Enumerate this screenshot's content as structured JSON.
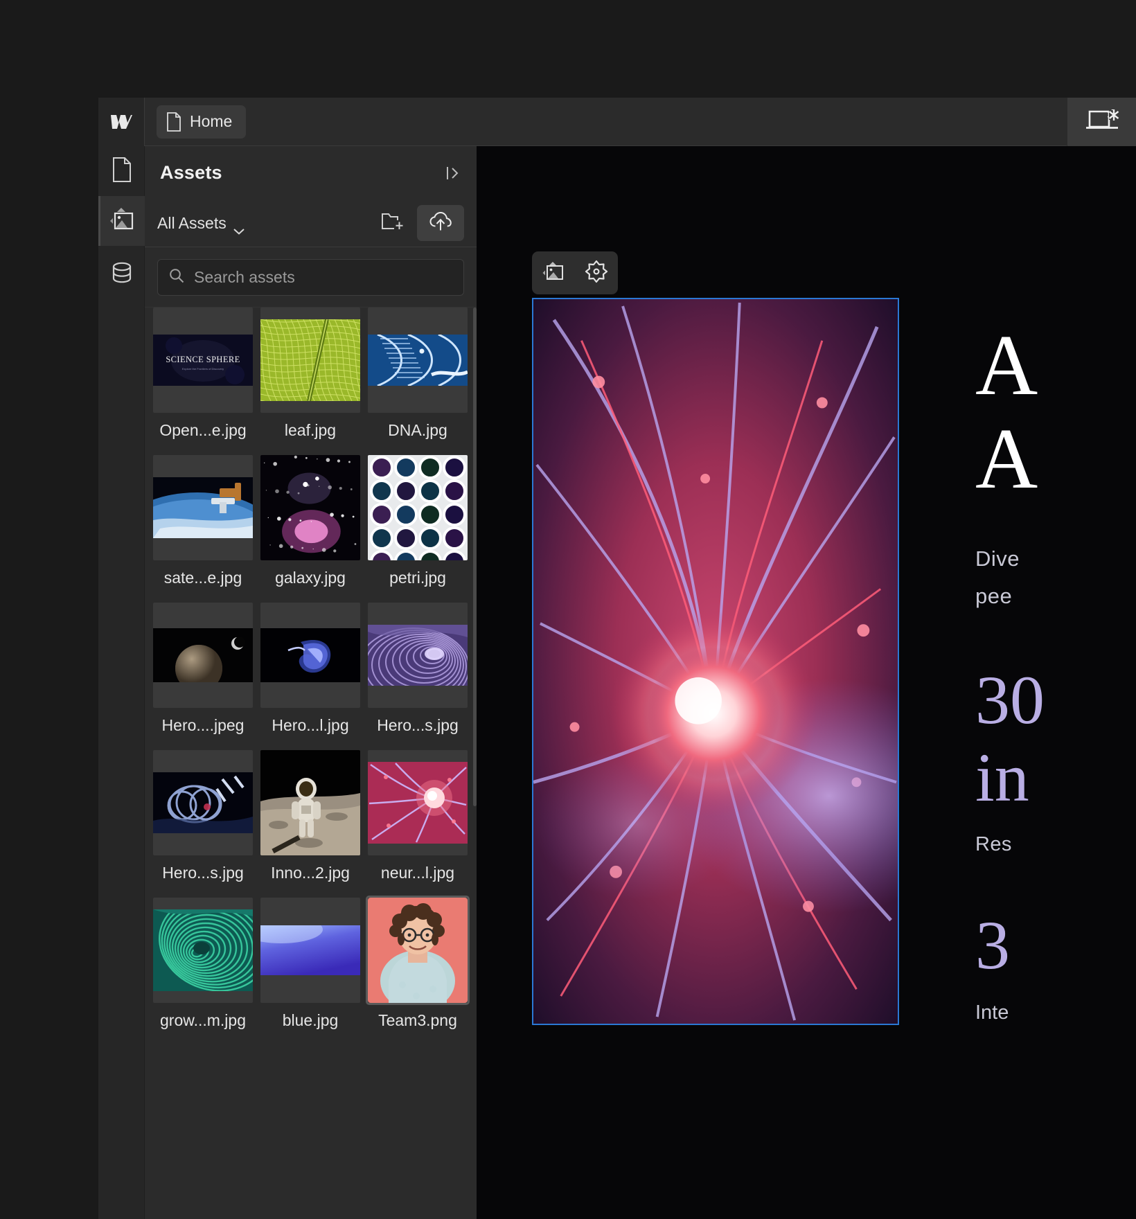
{
  "app": {
    "brand_icon": "webflow-logo-icon",
    "accent_selection": "#2b78d4",
    "panel_bg": "#2b2b2b"
  },
  "topbar": {
    "tab_label": "Home",
    "tab_icon": "page-icon",
    "breakpoint_icon": "desktop-breakpoint-asterisk-icon"
  },
  "rail": {
    "items": [
      {
        "icon": "pages-icon",
        "label": "Pages",
        "active": false
      },
      {
        "icon": "assets-image-icon",
        "label": "Assets",
        "active": true
      },
      {
        "icon": "cms-database-icon",
        "label": "CMS",
        "active": false
      }
    ]
  },
  "panel": {
    "title": "Assets",
    "collapse_icon": "collapse-panel-icon",
    "filter_label": "All Assets",
    "filter_chevron_icon": "chevron-down-icon",
    "new_folder_icon": "new-folder-icon",
    "upload_icon": "upload-cloud-icon",
    "search": {
      "placeholder": "Search assets",
      "value": "",
      "icon": "search-icon"
    },
    "assets": [
      {
        "name": "Open...e.jpg",
        "kind": "science-sphere-banner",
        "selected": false
      },
      {
        "name": "leaf.jpg",
        "kind": "leaf-macro",
        "selected": false
      },
      {
        "name": "DNA.jpg",
        "kind": "dna-helix",
        "selected": false
      },
      {
        "name": "sate...e.jpg",
        "kind": "satellite-earth",
        "selected": false
      },
      {
        "name": "galaxy.jpg",
        "kind": "galaxy-nebula",
        "selected": false
      },
      {
        "name": "petri.jpg",
        "kind": "petri-dish-array",
        "selected": false
      },
      {
        "name": "Hero....jpeg",
        "kind": "planet-moon",
        "selected": false
      },
      {
        "name": "Hero...l.jpg",
        "kind": "blue-swirl",
        "selected": false
      },
      {
        "name": "Hero...s.jpg",
        "kind": "purple-marble",
        "selected": false
      },
      {
        "name": "Hero...s.jpg",
        "kind": "glass-rings",
        "selected": false
      },
      {
        "name": "Inno...2.jpg",
        "kind": "astronaut-moon",
        "selected": false
      },
      {
        "name": "neur...l.jpg",
        "kind": "neuron-plasma",
        "selected": false
      },
      {
        "name": "grow...m.jpg",
        "kind": "teal-spiral",
        "selected": false
      },
      {
        "name": "blue.jpg",
        "kind": "blue-gradient",
        "selected": false
      },
      {
        "name": "Team3.png",
        "kind": "team-portrait",
        "selected": true
      }
    ]
  },
  "canvas": {
    "element_toolbar": {
      "image_icon": "image-element-icon",
      "settings_icon": "settings-gear-icon"
    },
    "selected_image": {
      "kind": "neuron-plasma-hero",
      "selected": true
    },
    "page_content": {
      "heading_line1": "A",
      "heading_line2": "A",
      "subtitle_line1": "Dive",
      "subtitle_line2": "pee",
      "stat1_line1": "30",
      "stat1_line2": "in",
      "stat1_caption": "Res",
      "stat2": "3",
      "stat2_caption": "Inte"
    }
  }
}
